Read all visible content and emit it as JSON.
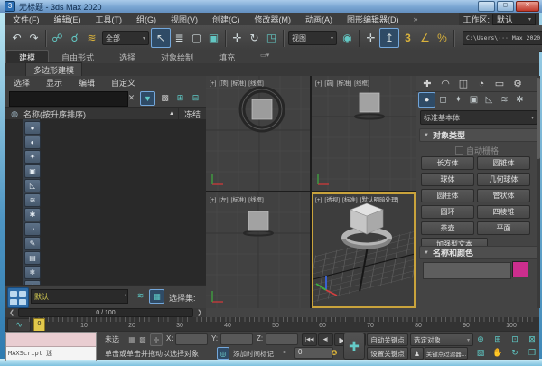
{
  "window": {
    "icon_glyph": "3",
    "title": "无标题 - 3ds Max 2020",
    "minimize_glyph": "—",
    "maximize_glyph": "▢",
    "close_glyph": "✕"
  },
  "menu_bar": {
    "items": [
      "文件(F)",
      "编辑(E)",
      "工具(T)",
      "组(G)",
      "视图(V)",
      "创建(C)",
      "修改器(M)",
      "动画(A)",
      "图形编辑器(D)"
    ],
    "overflow_glyph": "»",
    "workspace_label": "工作区:",
    "workspace_value": "默认",
    "caret": "▾"
  },
  "toolbar": {
    "icons": [
      {
        "name": "undo",
        "glyph": "↶"
      },
      {
        "name": "redo",
        "glyph": "↷"
      },
      {
        "name": "link",
        "glyph": "☍"
      },
      {
        "name": "unlink",
        "glyph": "☌"
      },
      {
        "name": "bind-spacewarp",
        "glyph": "≋"
      },
      {
        "name": "select-object",
        "glyph": "↖"
      },
      {
        "name": "select-by-name",
        "glyph": "≣"
      },
      {
        "name": "rect-region",
        "glyph": "▢"
      },
      {
        "name": "window-crossing",
        "glyph": "▣"
      },
      {
        "name": "move",
        "glyph": "✛"
      },
      {
        "name": "rotate",
        "glyph": "↻"
      },
      {
        "name": "scale",
        "glyph": "◳"
      },
      {
        "name": "pivot-center",
        "glyph": "◉"
      },
      {
        "name": "snap-toggle",
        "glyph": "✛"
      },
      {
        "name": "use-center",
        "glyph": "↥"
      },
      {
        "name": "snap-3d",
        "glyph": "3"
      },
      {
        "name": "angle-snap",
        "glyph": "∠"
      },
      {
        "name": "percent-snap",
        "glyph": "%"
      }
    ],
    "select_filter": "全部",
    "ref_coord": "视图",
    "project_path": "C:\\Users\\··· Max 2020",
    "caret": "▾"
  },
  "ribbon": {
    "tabs": [
      "建模",
      "自由形式",
      "选择",
      "对象绘制",
      "填充"
    ],
    "overflow_glyph": "▭▾",
    "panel_tab": "多边形建模"
  },
  "scene_explorer": {
    "menus": [
      "选择",
      "显示",
      "编辑",
      "自定义"
    ],
    "search_value": "",
    "clear_glyph": "✕",
    "filter_glyph": "▼",
    "lock_glyph": "▩",
    "expand_glyph": "⊞",
    "collapse_glyph": "⊟",
    "row_icon": "◍",
    "column_name": "名称(按升序排序)",
    "sort_arrow": "▲",
    "column_frozen": "冻结",
    "side_icons": [
      {
        "name": "display-all",
        "glyph": "●"
      },
      {
        "name": "display-geometry",
        "glyph": "◐"
      },
      {
        "name": "display-lights",
        "glyph": "✦"
      },
      {
        "name": "display-cameras",
        "glyph": "▣"
      },
      {
        "name": "display-helpers",
        "glyph": "◺"
      },
      {
        "name": "display-spacewarps",
        "glyph": "≋"
      },
      {
        "name": "display-particles",
        "glyph": "✱"
      },
      {
        "name": "display-bones",
        "glyph": "◔"
      },
      {
        "name": "display-shapes",
        "glyph": "✎"
      },
      {
        "name": "display-containers",
        "glyph": "▤"
      },
      {
        "name": "display-frozen",
        "glyph": "❄"
      },
      {
        "name": "display-hidden",
        "glyph": "◉"
      }
    ],
    "set_field_value": "默认",
    "selection_set_label": "选择集:"
  },
  "viewports": {
    "top_labels": [
      "[+]",
      "[顶]",
      "[标准]",
      "[线框]"
    ],
    "front_labels": [
      "[+]",
      "[前]",
      "[标准]",
      "[线框]"
    ],
    "left_labels": [
      "[+]",
      "[左]",
      "[标准]",
      "[线框]"
    ],
    "persp_labels": [
      "[+]",
      "[透视]",
      "[标准]",
      "[默认明暗处理]"
    ]
  },
  "command_panel": {
    "tabs": [
      {
        "name": "create",
        "glyph": "✚"
      },
      {
        "name": "modify",
        "glyph": "◠"
      },
      {
        "name": "hierarchy",
        "glyph": "◫"
      },
      {
        "name": "motion",
        "glyph": "◔"
      },
      {
        "name": "display",
        "glyph": "▭"
      },
      {
        "name": "utilities",
        "glyph": "⚙"
      }
    ],
    "categories": [
      {
        "name": "geometry",
        "glyph": "●"
      },
      {
        "name": "shapes",
        "glyph": "◻"
      },
      {
        "name": "lights",
        "glyph": "✦"
      },
      {
        "name": "cameras",
        "glyph": "▣"
      },
      {
        "name": "helpers",
        "glyph": "◺"
      },
      {
        "name": "space-warps",
        "glyph": "≋"
      },
      {
        "name": "systems",
        "glyph": "✲"
      }
    ],
    "category_dropdown": "标准基本体",
    "caret": "▾",
    "rollout_object_type": "对象类型",
    "autogrid_label": "自动栅格",
    "buttons": [
      "长方体",
      "圆锥体",
      "球体",
      "几何球体",
      "圆柱体",
      "管状体",
      "圆环",
      "四棱锥",
      "茶壶",
      "平面",
      "加强型文本"
    ],
    "rollout_name_color": "名称和颜色",
    "name_value": "",
    "swatch_color": "#cc2e8e"
  },
  "timeline": {
    "prev_glyph": "❮",
    "next_glyph": "❯",
    "frame_display": "0 / 100",
    "curve_glyph": "∿",
    "marker": "0",
    "tick_labels": [
      "10",
      "20",
      "30",
      "40",
      "50",
      "60",
      "70",
      "80",
      "90",
      "100"
    ]
  },
  "status_bar": {
    "maxscript_label": "MAXScript 迷",
    "selection_status": "未选",
    "prompt": "单击或单击并拖动以选择对象",
    "grid_icon_glyph": "▦",
    "lock_icon_glyph": "▩",
    "transform_gizmo_glyph": "✛",
    "x_label": "X:",
    "y_label": "Y:",
    "z_label": "Z:",
    "isolate_glyph": "◎",
    "time_tag_label": "添加时间标记",
    "spinner_glyph": "◂▸",
    "frame_value": "0",
    "key_mode_glyph": "✪",
    "playback": [
      "|◀◀",
      "◀|",
      "▶",
      "|▶",
      "▶▶|"
    ],
    "setkey_plus_glyph": "✚",
    "auto_key": "自动关键点",
    "set_key": "设置关键点",
    "selection_set": "选定对象",
    "character_glyph": "♟",
    "key_filters": "关键点过滤器...",
    "nav": [
      {
        "name": "zoom",
        "glyph": "⊕"
      },
      {
        "name": "zoom-all",
        "glyph": "⊞"
      },
      {
        "name": "zoom-extents",
        "glyph": "⊡"
      },
      {
        "name": "zoom-extents-all",
        "glyph": "⊠"
      },
      {
        "name": "zoom-region",
        "glyph": "▧"
      },
      {
        "name": "pan",
        "glyph": "✋"
      },
      {
        "name": "orbit",
        "glyph": "↻"
      },
      {
        "name": "maximize-viewport",
        "glyph": "❒"
      }
    ]
  }
}
